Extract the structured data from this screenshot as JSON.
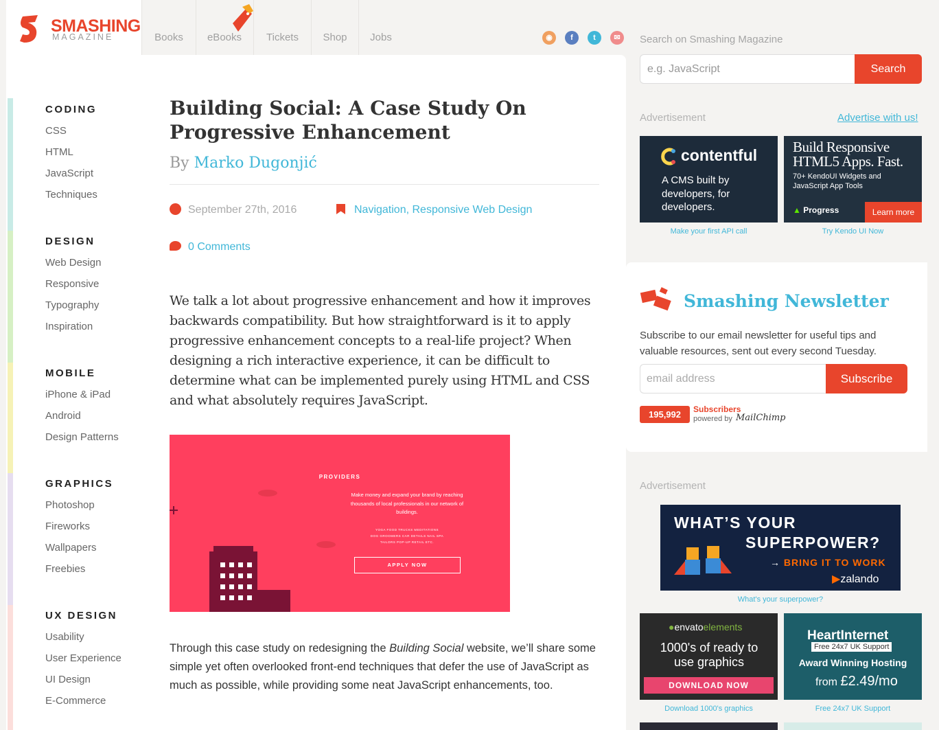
{
  "logo": {
    "name": "SMASHING",
    "sub": "MAGAZINE"
  },
  "nav": {
    "items": [
      "Books",
      "eBooks",
      "Tickets",
      "Shop",
      "Jobs"
    ]
  },
  "social": {
    "icons": [
      "rss-icon",
      "facebook-icon",
      "twitter-icon",
      "email-icon"
    ]
  },
  "search": {
    "label": "Search on Smashing Magazine",
    "placeholder": "e.g. JavaScript",
    "button": "Search"
  },
  "sidebar": {
    "categories": [
      {
        "title": "CODING",
        "color": "#c8ebe6",
        "links": [
          "CSS",
          "HTML",
          "JavaScript",
          "Techniques"
        ]
      },
      {
        "title": "DESIGN",
        "color": "#d6f0c4",
        "links": [
          "Web Design",
          "Responsive",
          "Typography",
          "Inspiration"
        ]
      },
      {
        "title": "MOBILE",
        "color": "#f6f2b6",
        "links": [
          "iPhone & iPad",
          "Android",
          "Design Patterns"
        ]
      },
      {
        "title": "GRAPHICS",
        "color": "#e6ddf0",
        "links": [
          "Photoshop",
          "Fireworks",
          "Wallpapers",
          "Freebies"
        ]
      },
      {
        "title": "UX DESIGN",
        "color": "#fcdedb",
        "links": [
          "Usability",
          "User Experience",
          "UI Design",
          "E-Commerce"
        ]
      }
    ]
  },
  "article": {
    "title": "Building Social: A Case Study On Progressive Enhancement",
    "by": "By",
    "author": "Marko Dugonjić",
    "date": "September 27th, 2016",
    "tags": "Navigation, Responsive Web Design",
    "comments": "0 Comments",
    "lead": "We talk a lot about progressive enhancement and how it improves backwards compatibility. But how straightforward is it to apply progressive enhancement concepts to a real-life project? When designing a rich interactive experience, it can be difficult to determine what can be implemented purely using HTML and CSS and what absolutely requires JavaScript.",
    "hero": {
      "title": "PROVIDERS",
      "desc": "Make money and expand your brand by reaching thousands of local professionals in our network of buildings.",
      "cats_line1": "YOGA   FOOD TRUCKS   MEDITATIONS",
      "cats_line2": "DOG GROOMERS   CAR DETAILS   NAIL SPA",
      "cats_line3": "TAILORS   POP-UP RETAIL   ETC.",
      "button": "APPLY NOW"
    },
    "body_pre": "Through this case study on redesigning the ",
    "body_em": "Building Social",
    "body_post": " website, we’ll share some simple yet often overlooked front-end techniques that defer the use of JavaScript as much as possible, while providing some neat JavaScript enhancements, too."
  },
  "ads": {
    "label": "Advertisement",
    "advertise_link": "Advertise with us!",
    "contentful": {
      "brand": "contentful",
      "text": "A CMS built by developers, for developers.",
      "caption": "Make your first API call"
    },
    "kendo": {
      "headline": "Build Responsive HTML5 Apps. Fast.",
      "sub": "70+ KendoUI Widgets and JavaScript App Tools",
      "brand": "Progress",
      "cta": "Learn more",
      "caption": "Try Kendo UI Now"
    },
    "zalando": {
      "line1": "WHAT’S YOUR",
      "line2": "SUPERPOWER?",
      "cta": "BRING IT TO WORK",
      "brand": "zalando",
      "caption": "What's your superpower?"
    },
    "envato": {
      "brand": "envato",
      "brand2": "elements",
      "text": "1000's of ready to use graphics",
      "button": "DOWNLOAD NOW",
      "caption": "Download 1000's graphics"
    },
    "heart": {
      "brand": "HeartInternet",
      "support": "Free 24x7 UK Support",
      "text": "Award Winning Hosting",
      "price_from": "from",
      "price": "£2.49/mo",
      "caption": "Free 24x7 UK Support"
    }
  },
  "newsletter": {
    "title": "Smashing Newsletter",
    "desc": "Subscribe to our email newsletter for useful tips and valuable resources, sent out every second Tuesday.",
    "placeholder": "email address",
    "button": "Subscribe",
    "count": "195,992",
    "count_label": "Subscribers",
    "powered": "powered by",
    "provider": "MailChimp"
  },
  "colors": {
    "accent": "#e8452c",
    "link": "#41b7d8"
  }
}
